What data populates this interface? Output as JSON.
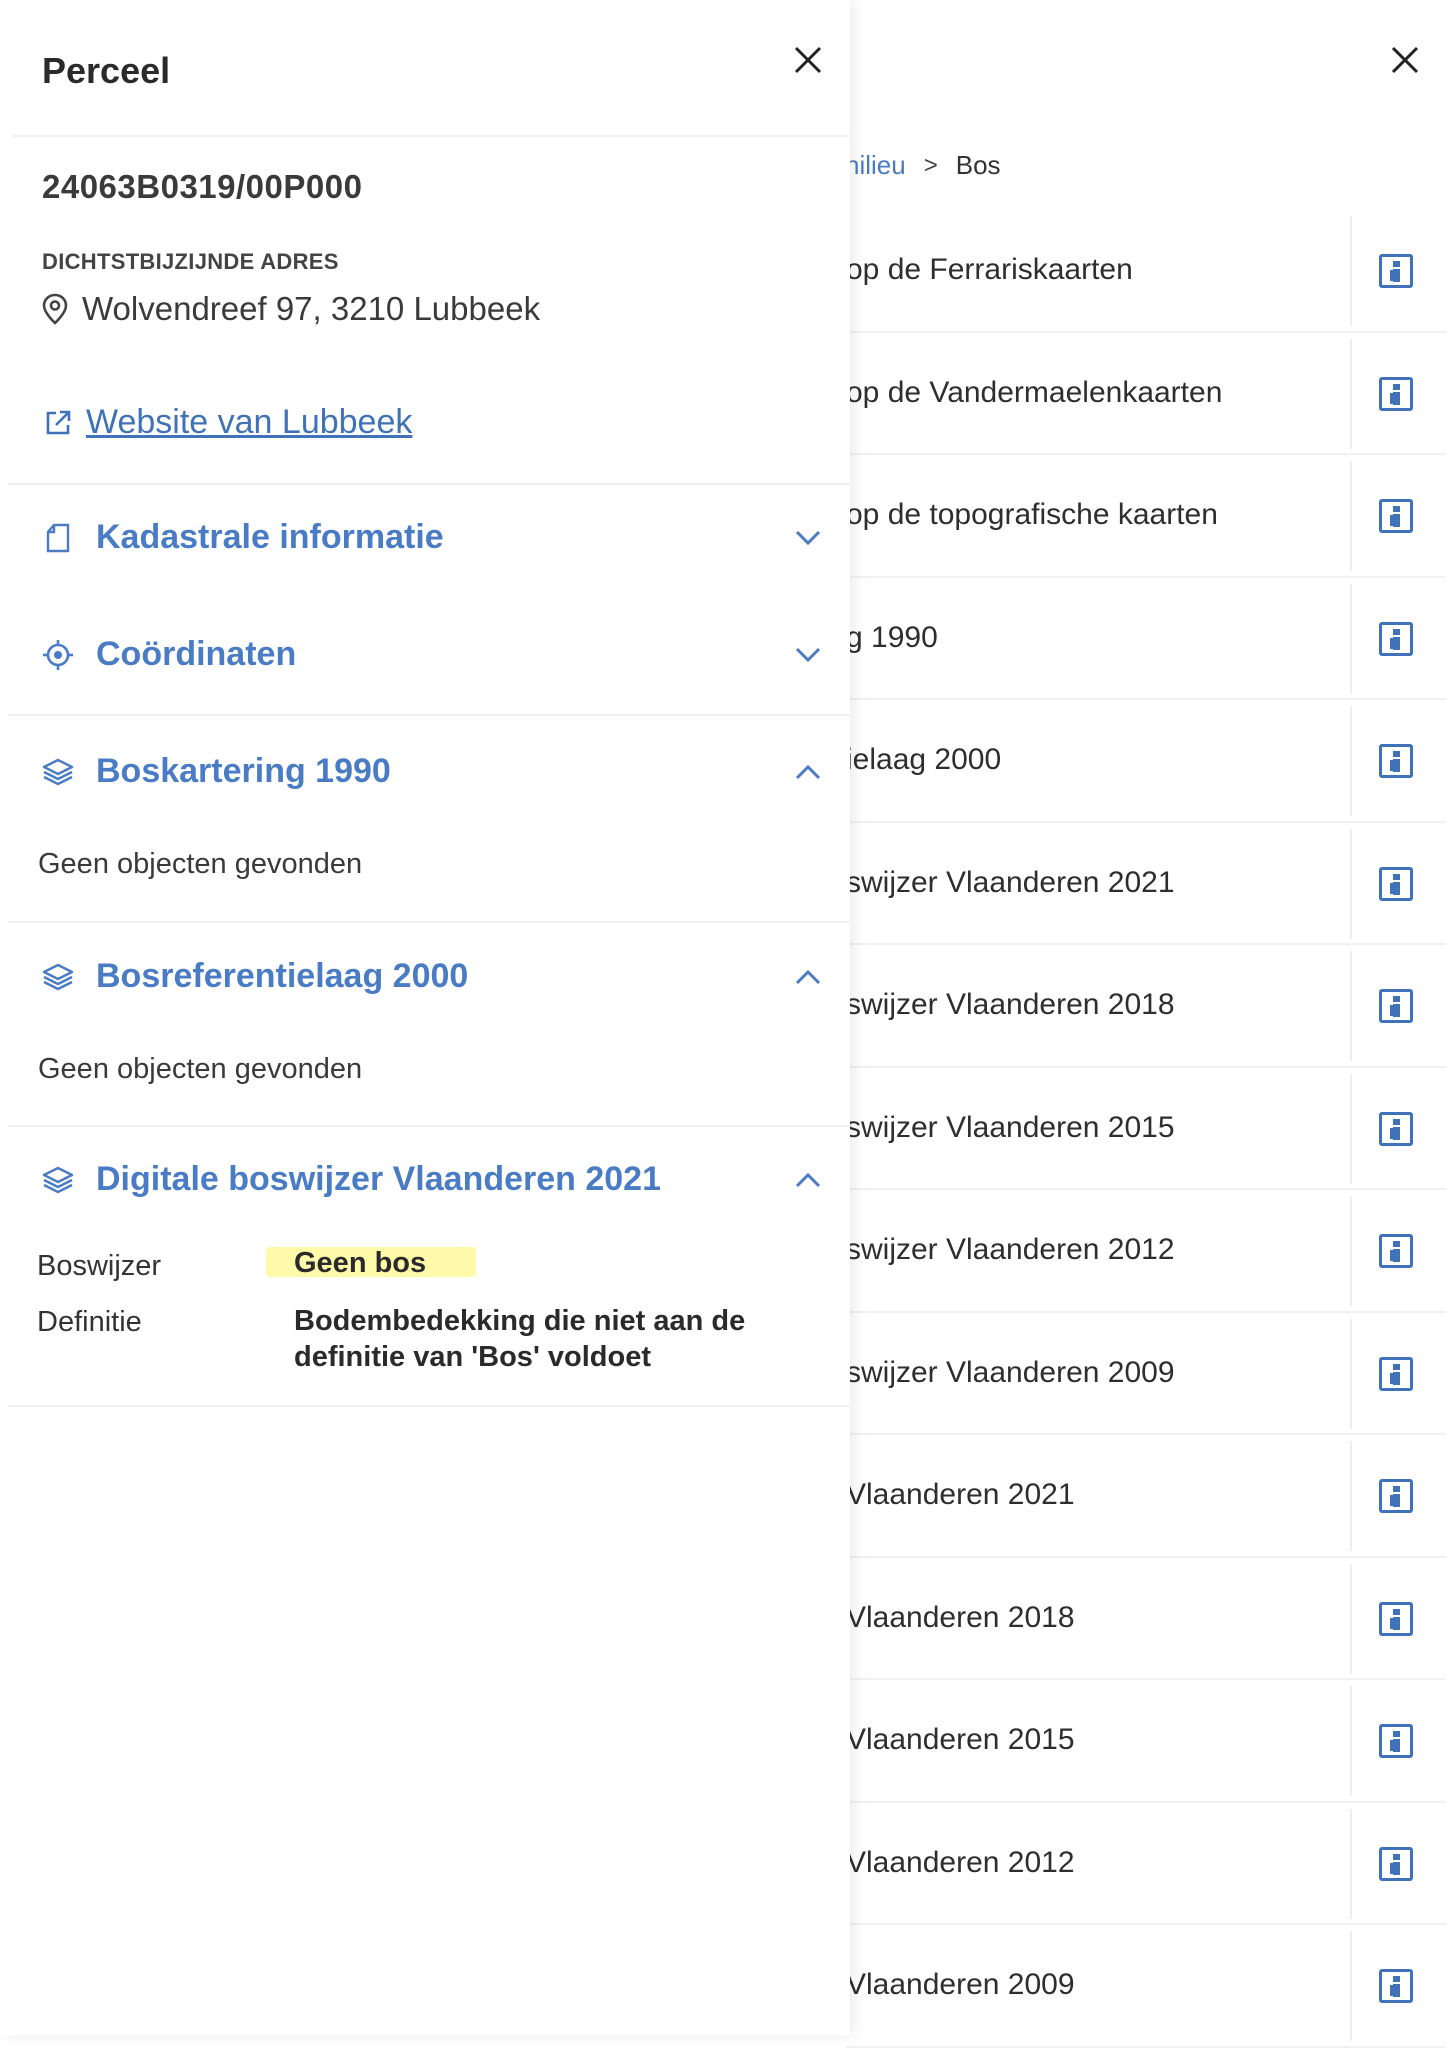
{
  "background_panel": {
    "breadcrumb": {
      "parent": "nilieu",
      "separator": ">",
      "current": "Bos"
    },
    "layers": [
      {
        "label": "op de Ferrariskaarten"
      },
      {
        "label": "op de Vandermaelenkaarten"
      },
      {
        "label": "op de topografische kaarten"
      },
      {
        "label": "g 1990"
      },
      {
        "label": "ielaag 2000"
      },
      {
        "label": "swijzer Vlaanderen 2021"
      },
      {
        "label": "swijzer Vlaanderen 2018"
      },
      {
        "label": "swijzer Vlaanderen 2015"
      },
      {
        "label": "swijzer Vlaanderen 2012"
      },
      {
        "label": "swijzer Vlaanderen 2009"
      },
      {
        "label": "Vlaanderen 2021"
      },
      {
        "label": "Vlaanderen 2018"
      },
      {
        "label": "Vlaanderen 2015"
      },
      {
        "label": "Vlaanderen 2012"
      },
      {
        "label": "Vlaanderen 2009"
      }
    ]
  },
  "perceel_panel": {
    "title": "Perceel",
    "parcel_id": "24063B0319/00P000",
    "address_label": "DICHTSTBIJZIJNDE ADRES",
    "address": "Wolvendreef 97, 3210 Lubbeek",
    "website_link": "Website van Lubbeek",
    "sections": {
      "kadastrale": {
        "title": "Kadastrale informatie"
      },
      "coordinaten": {
        "title": "Coördinaten"
      },
      "boskartering": {
        "title": "Boskartering 1990",
        "body": "Geen objecten gevonden"
      },
      "bosreferentie": {
        "title": "Bosreferentielaag 2000",
        "body": "Geen objecten gevonden"
      },
      "boswijzer": {
        "title": "Digitale boswijzer Vlaanderen 2021",
        "rows": [
          {
            "label": "Boswijzer",
            "value": "Geen bos"
          },
          {
            "label": "Definitie",
            "value_line1": "Bodembedekking die niet aan de",
            "value_line2": "definitie van 'Bos' voldoet"
          }
        ]
      }
    }
  },
  "colors": {
    "accent": "#4a7cc6",
    "link": "#3f72b8",
    "highlight": "#fff664"
  }
}
